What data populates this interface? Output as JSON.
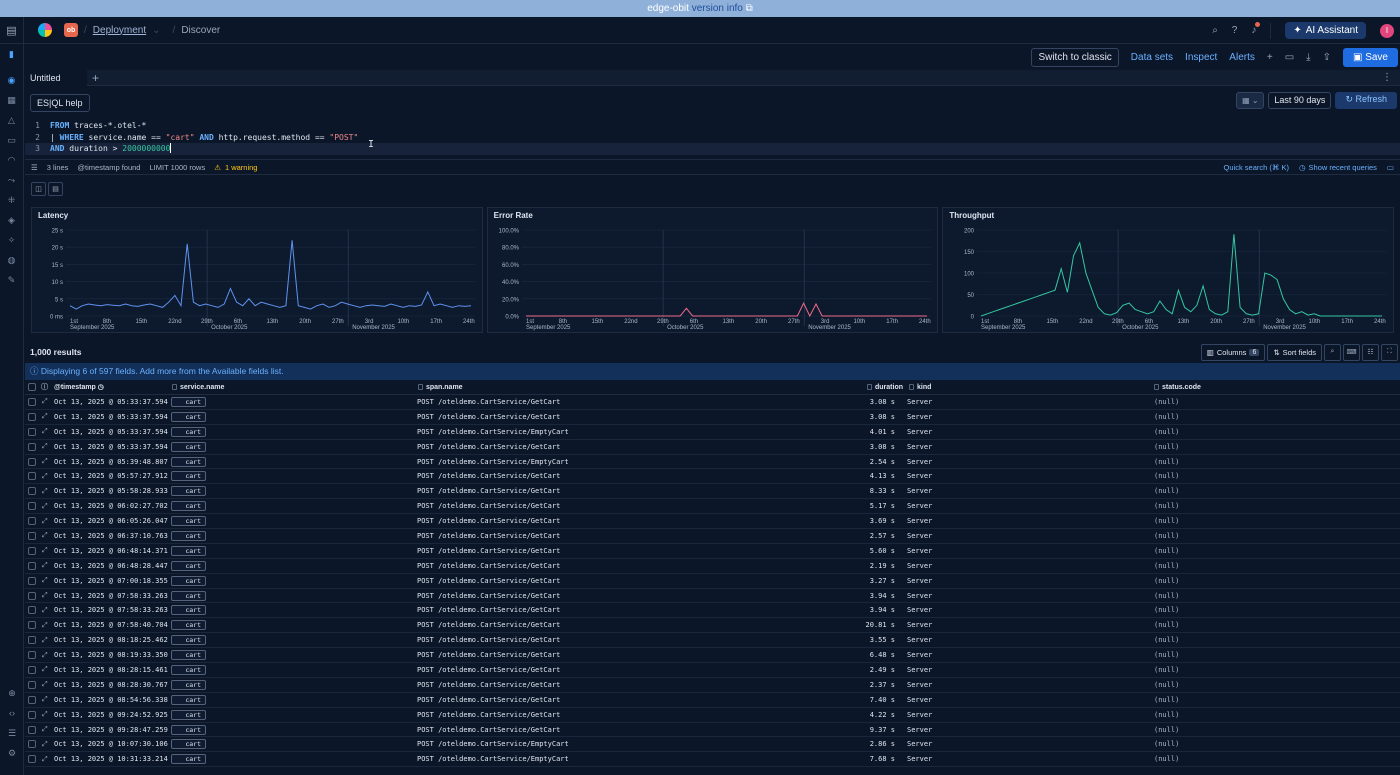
{
  "banner": {
    "prefix": "edge-obit",
    "link": "version info"
  },
  "header": {
    "space_badge": "ob",
    "breadcrumb_parent": "Deployment",
    "breadcrumb_current": "Discover",
    "ai_assistant": "AI Assistant",
    "avatar": "I"
  },
  "toolbar": {
    "switch_classic": "Switch to classic",
    "data_sets": "Data sets",
    "inspect": "Inspect",
    "alerts": "Alerts",
    "save": "Save"
  },
  "tabs": [
    {
      "label": "Untitled"
    }
  ],
  "query_bar": {
    "help": "ES|QL help",
    "range": "Last 90 days",
    "refresh": "Refresh"
  },
  "editor": {
    "lines": [
      {
        "n": "1"
      },
      {
        "n": "2"
      },
      {
        "n": "3"
      }
    ],
    "l1_kw": "FROM",
    "l1_rest": " traces-*.otel-*",
    "l2_pipe": "| ",
    "l2_kw1": "WHERE",
    "l2_a": " service.name == ",
    "l2_s1": "\"cart\"",
    "l2_kw2": " AND",
    "l2_b": " http.request.method == ",
    "l2_s2": "\"POST\"",
    "l3_kw": "AND",
    "l3_a": " duration > ",
    "l3_num": "2000000000"
  },
  "status": {
    "lines": "3 lines",
    "timestamp": "@timestamp found",
    "limit": "LIMIT 1000 rows",
    "warning": "1 warning",
    "quick_search": "Quick search (⌘ K)",
    "recent": "Show recent queries"
  },
  "chart_data": [
    {
      "type": "line",
      "title": "Latency",
      "color": "#6092f0",
      "y_ticks": [
        "25 s",
        "20 s",
        "15 s",
        "10 s",
        "5 s",
        "0 ms"
      ],
      "x_ticks": [
        "1st",
        "8th",
        "15th",
        "22nd",
        "29th",
        "6th",
        "13th",
        "20th",
        "27th",
        "3rd",
        "10th",
        "17th",
        "24th"
      ],
      "x_month_labels": [
        "September 2025",
        "October 2025",
        "November 2025"
      ],
      "ylim": [
        0,
        25
      ],
      "values": [
        3,
        2,
        3,
        3.5,
        3.2,
        3,
        3.3,
        3.1,
        3,
        3.5,
        3,
        2.8,
        3.2,
        3.5,
        3,
        2.5,
        4,
        6,
        3,
        21,
        4,
        3,
        3.5,
        3,
        2.5,
        3.5,
        8,
        4,
        3,
        5,
        3,
        4,
        3.5,
        3,
        2.5,
        3,
        22,
        3,
        2.5,
        2,
        3,
        3.5,
        2.5,
        3,
        4,
        3.5,
        3,
        2.5,
        3,
        3.2,
        3,
        2.8,
        3.5,
        3,
        2.5,
        3,
        2.8,
        3.2,
        7,
        3,
        3.5,
        3,
        2.5,
        3,
        2.8,
        3
      ]
    },
    {
      "type": "line",
      "title": "Error Rate",
      "color": "#f06a8a",
      "y_ticks": [
        "100.0%",
        "80.0%",
        "60.0%",
        "40.0%",
        "20.0%",
        "0.0%"
      ],
      "x_ticks": [
        "1st",
        "8th",
        "15th",
        "22nd",
        "29th",
        "6th",
        "13th",
        "20th",
        "27th",
        "3rd",
        "10th",
        "17th",
        "24th"
      ],
      "x_month_labels": [
        "September 2025",
        "October 2025",
        "November 2025"
      ],
      "ylim": [
        0,
        100
      ],
      "values": [
        0,
        0,
        0,
        0,
        0,
        0,
        0,
        0,
        0,
        0,
        0,
        0,
        0,
        0,
        0,
        0,
        0,
        0,
        0,
        0,
        0,
        0,
        0,
        0,
        0,
        0,
        9,
        0,
        0,
        0,
        0,
        0,
        0,
        0,
        0,
        0,
        0,
        0,
        0,
        0,
        0,
        0,
        0,
        0,
        0,
        15,
        0,
        14,
        0,
        0,
        0,
        0,
        0,
        0,
        0,
        0,
        0,
        0,
        0,
        0,
        0,
        0,
        0,
        0,
        0,
        0
      ]
    },
    {
      "type": "line",
      "title": "Throughput",
      "color": "#35c7a0",
      "y_ticks": [
        "200",
        "150",
        "100",
        "50",
        "0"
      ],
      "x_ticks": [
        "1st",
        "8th",
        "15th",
        "22nd",
        "29th",
        "6th",
        "13th",
        "20th",
        "27th",
        "3rd",
        "10th",
        "17th",
        "24th"
      ],
      "x_month_labels": [
        "September 2025",
        "October 2025",
        "November 2025"
      ],
      "ylim": [
        0,
        200
      ],
      "values": [
        0,
        5,
        10,
        15,
        20,
        25,
        30,
        35,
        40,
        45,
        50,
        55,
        60,
        110,
        55,
        140,
        170,
        100,
        60,
        20,
        5,
        2,
        8,
        25,
        30,
        15,
        10,
        5,
        10,
        35,
        15,
        5,
        60,
        20,
        10,
        25,
        70,
        15,
        5,
        2,
        10,
        190,
        20,
        5,
        2,
        5,
        100,
        95,
        85,
        40,
        15,
        5,
        10,
        2,
        5,
        0,
        0,
        0,
        0,
        0,
        0,
        0,
        0,
        0,
        0,
        0
      ]
    }
  ],
  "results": {
    "count": "1,000 results",
    "columns": "Columns",
    "columns_count": "6",
    "sort_fields": "Sort fields",
    "callout": "Displaying 6 of 597 fields. Add more from the Available fields list.",
    "headers": {
      "timestamp": "@timestamp",
      "service": "service.name",
      "span": "span.name",
      "duration": "duration",
      "kind": "kind",
      "status": "status.code"
    },
    "rows": [
      {
        "ts": "Oct 13, 2025 @ 05:33:37.594",
        "svc": "cart",
        "span": "POST /oteldemo.CartService/GetCart",
        "dur": "3.08 s",
        "kind": "Server",
        "status": "(null)"
      },
      {
        "ts": "Oct 13, 2025 @ 05:33:37.594",
        "svc": "cart",
        "span": "POST /oteldemo.CartService/GetCart",
        "dur": "3.08 s",
        "kind": "Server",
        "status": "(null)"
      },
      {
        "ts": "Oct 13, 2025 @ 05:33:37.594",
        "svc": "cart",
        "span": "POST /oteldemo.CartService/EmptyCart",
        "dur": "4.01 s",
        "kind": "Server",
        "status": "(null)"
      },
      {
        "ts": "Oct 13, 2025 @ 05:33:37.594",
        "svc": "cart",
        "span": "POST /oteldemo.CartService/GetCart",
        "dur": "3.08 s",
        "kind": "Server",
        "status": "(null)"
      },
      {
        "ts": "Oct 13, 2025 @ 05:39:48.807",
        "svc": "cart",
        "span": "POST /oteldemo.CartService/EmptyCart",
        "dur": "2.54 s",
        "kind": "Server",
        "status": "(null)"
      },
      {
        "ts": "Oct 13, 2025 @ 05:57:27.912",
        "svc": "cart",
        "span": "POST /oteldemo.CartService/GetCart",
        "dur": "4.13 s",
        "kind": "Server",
        "status": "(null)"
      },
      {
        "ts": "Oct 13, 2025 @ 05:58:28.933",
        "svc": "cart",
        "span": "POST /oteldemo.CartService/GetCart",
        "dur": "8.33 s",
        "kind": "Server",
        "status": "(null)"
      },
      {
        "ts": "Oct 13, 2025 @ 06:02:27.702",
        "svc": "cart",
        "span": "POST /oteldemo.CartService/GetCart",
        "dur": "5.17 s",
        "kind": "Server",
        "status": "(null)"
      },
      {
        "ts": "Oct 13, 2025 @ 06:05:26.047",
        "svc": "cart",
        "span": "POST /oteldemo.CartService/GetCart",
        "dur": "3.69 s",
        "kind": "Server",
        "status": "(null)"
      },
      {
        "ts": "Oct 13, 2025 @ 06:37:10.763",
        "svc": "cart",
        "span": "POST /oteldemo.CartService/GetCart",
        "dur": "2.57 s",
        "kind": "Server",
        "status": "(null)"
      },
      {
        "ts": "Oct 13, 2025 @ 06:48:14.371",
        "svc": "cart",
        "span": "POST /oteldemo.CartService/GetCart",
        "dur": "5.60 s",
        "kind": "Server",
        "status": "(null)"
      },
      {
        "ts": "Oct 13, 2025 @ 06:48:28.447",
        "svc": "cart",
        "span": "POST /oteldemo.CartService/GetCart",
        "dur": "2.19 s",
        "kind": "Server",
        "status": "(null)"
      },
      {
        "ts": "Oct 13, 2025 @ 07:00:18.355",
        "svc": "cart",
        "span": "POST /oteldemo.CartService/GetCart",
        "dur": "3.27 s",
        "kind": "Server",
        "status": "(null)"
      },
      {
        "ts": "Oct 13, 2025 @ 07:58:33.263",
        "svc": "cart",
        "span": "POST /oteldemo.CartService/GetCart",
        "dur": "3.94 s",
        "kind": "Server",
        "status": "(null)"
      },
      {
        "ts": "Oct 13, 2025 @ 07:58:33.263",
        "svc": "cart",
        "span": "POST /oteldemo.CartService/GetCart",
        "dur": "3.94 s",
        "kind": "Server",
        "status": "(null)"
      },
      {
        "ts": "Oct 13, 2025 @ 07:58:40.704",
        "svc": "cart",
        "span": "POST /oteldemo.CartService/GetCart",
        "dur": "20.81 s",
        "kind": "Server",
        "status": "(null)"
      },
      {
        "ts": "Oct 13, 2025 @ 08:18:25.462",
        "svc": "cart",
        "span": "POST /oteldemo.CartService/GetCart",
        "dur": "3.55 s",
        "kind": "Server",
        "status": "(null)"
      },
      {
        "ts": "Oct 13, 2025 @ 08:19:33.350",
        "svc": "cart",
        "span": "POST /oteldemo.CartService/GetCart",
        "dur": "6.48 s",
        "kind": "Server",
        "status": "(null)"
      },
      {
        "ts": "Oct 13, 2025 @ 08:28:15.461",
        "svc": "cart",
        "span": "POST /oteldemo.CartService/GetCart",
        "dur": "2.49 s",
        "kind": "Server",
        "status": "(null)"
      },
      {
        "ts": "Oct 13, 2025 @ 08:28:30.767",
        "svc": "cart",
        "span": "POST /oteldemo.CartService/GetCart",
        "dur": "2.37 s",
        "kind": "Server",
        "status": "(null)"
      },
      {
        "ts": "Oct 13, 2025 @ 08:54:56.338",
        "svc": "cart",
        "span": "POST /oteldemo.CartService/GetCart",
        "dur": "7.40 s",
        "kind": "Server",
        "status": "(null)"
      },
      {
        "ts": "Oct 13, 2025 @ 09:24:52.925",
        "svc": "cart",
        "span": "POST /oteldemo.CartService/GetCart",
        "dur": "4.22 s",
        "kind": "Server",
        "status": "(null)"
      },
      {
        "ts": "Oct 13, 2025 @ 09:28:47.259",
        "svc": "cart",
        "span": "POST /oteldemo.CartService/GetCart",
        "dur": "9.37 s",
        "kind": "Server",
        "status": "(null)"
      },
      {
        "ts": "Oct 13, 2025 @ 10:07:30.106",
        "svc": "cart",
        "span": "POST /oteldemo.CartService/EmptyCart",
        "dur": "2.86 s",
        "kind": "Server",
        "status": "(null)"
      },
      {
        "ts": "Oct 13, 2025 @ 10:31:33.214",
        "svc": "cart",
        "span": "POST /oteldemo.CartService/EmptyCart",
        "dur": "7.68 s",
        "kind": "Server",
        "status": "(null)"
      }
    ]
  }
}
